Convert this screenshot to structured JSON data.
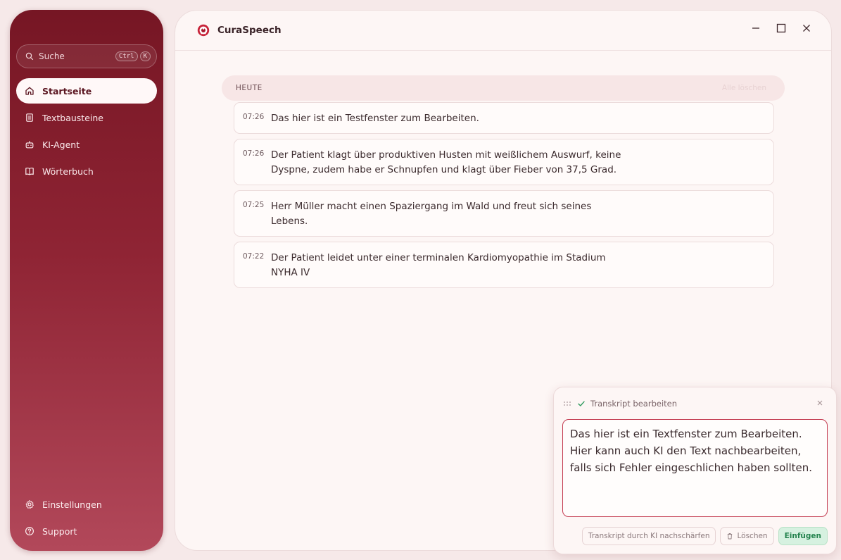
{
  "sidebar": {
    "search": {
      "label": "Suche",
      "kbd1": "Ctrl",
      "kbd2": "K"
    },
    "items": [
      {
        "label": "Startseite",
        "icon": "home-icon"
      },
      {
        "label": "Textbausteine",
        "icon": "document-icon"
      },
      {
        "label": "KI-Agent",
        "icon": "robot-icon"
      },
      {
        "label": "Wörterbuch",
        "icon": "book-icon"
      }
    ],
    "bottom": [
      {
        "label": "Einstellungen",
        "icon": "gear-icon"
      },
      {
        "label": "Support",
        "icon": "help-icon"
      }
    ]
  },
  "app": {
    "title": "CuraSpeech"
  },
  "section": {
    "label": "HEUTE",
    "right_label": "Alle löschen"
  },
  "entries": [
    {
      "time": "07:26",
      "text": "Das hier ist ein Testfenster zum Bearbeiten."
    },
    {
      "time": "07:26",
      "text": "Der Patient klagt über produktiven Husten mit weißlichem Auswurf, keine Dyspne, zudem habe er Schnupfen und klagt über Fieber von 37,5 Grad."
    },
    {
      "time": "07:25",
      "text": "Herr Müller macht einen Spaziergang im Wald und freut sich seines Lebens."
    },
    {
      "time": "07:22",
      "text": "Der Patient leidet unter einer terminalen Kardiomyopathie im Stadium NYHA IV"
    }
  ],
  "panel": {
    "title": "Transkript bearbeiten",
    "text": "Das hier ist ein Textfenster zum Bearbeiten. Hier kann auch KI den Text nachbearbeiten, falls sich Fehler eingeschlichen haben sollten.",
    "btn_ai": "Transkript durch KI nachschärfen",
    "btn_delete": "Löschen",
    "btn_insert": "Einfügen"
  },
  "colors": {
    "accent": "#8f2434",
    "success": "#24834e"
  }
}
